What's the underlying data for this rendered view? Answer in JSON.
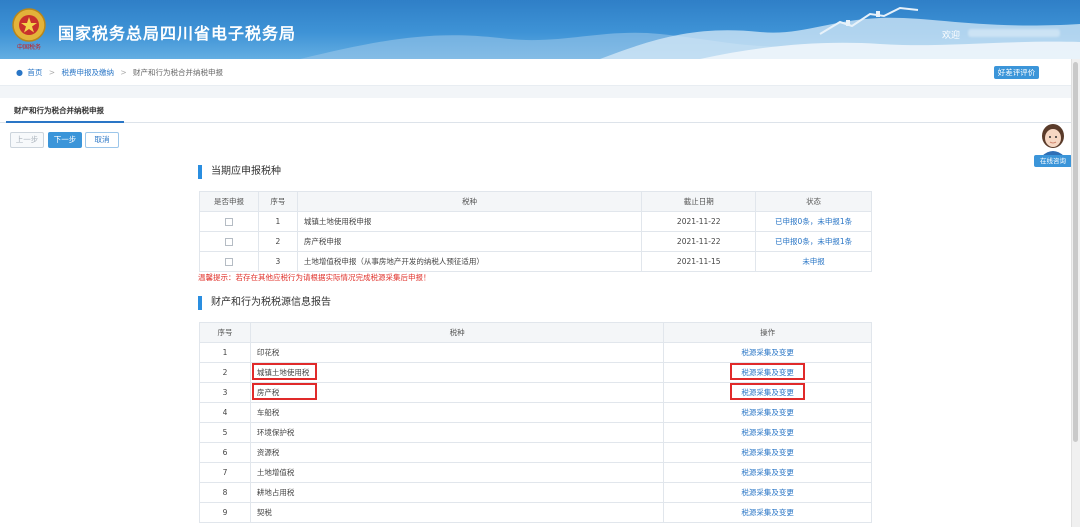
{
  "header": {
    "emblem_text": "中国税务",
    "title": "国家税务总局四川省电子税务局",
    "welcome": "欢迎"
  },
  "breadcrumb": {
    "home": "首页",
    "level1": "税费申报及缴纳",
    "current": "财产和行为税合并纳税申报"
  },
  "eval_button": "好差评评价",
  "tab": "财产和行为税合并纳税申报",
  "steps": {
    "prev": "上一步",
    "next": "下一步",
    "cancel": "取消"
  },
  "consult": "在线咨询",
  "section1": {
    "title": "当期应申报税种",
    "headers": [
      "是否申报",
      "序号",
      "税种",
      "截止日期",
      "状态"
    ],
    "rows": [
      {
        "no": "1",
        "tax": "城镇土地使用税申报",
        "deadline": "2021-11-22",
        "status": "已申报0条，未申报1条"
      },
      {
        "no": "2",
        "tax": "房产税申报",
        "deadline": "2021-11-22",
        "status": "已申报0条，未申报1条"
      },
      {
        "no": "3",
        "tax": "土地增值税申报（从事房地产开发的纳税人预征适用）",
        "deadline": "2021-11-15",
        "status": "未申报"
      }
    ],
    "tip": "温馨提示：若存在其他应税行为请根据实际情况完成税源采集后申报！"
  },
  "section2": {
    "title": "财产和行为税税源信息报告",
    "headers": [
      "序号",
      "税种",
      "操作"
    ],
    "action": "税源采集及变更",
    "rows": [
      {
        "no": "1",
        "tax": "印花税"
      },
      {
        "no": "2",
        "tax": "城镇土地使用税"
      },
      {
        "no": "3",
        "tax": "房产税"
      },
      {
        "no": "4",
        "tax": "车船税"
      },
      {
        "no": "5",
        "tax": "环境保护税"
      },
      {
        "no": "6",
        "tax": "资源税"
      },
      {
        "no": "7",
        "tax": "土地增值税"
      },
      {
        "no": "8",
        "tax": "耕地占用税"
      },
      {
        "no": "9",
        "tax": "契税"
      }
    ]
  },
  "colors": {
    "accent": "#2a76c6",
    "banner": "#3e93d6",
    "highlight": "#e02a2a",
    "tip": "#e0302a"
  }
}
